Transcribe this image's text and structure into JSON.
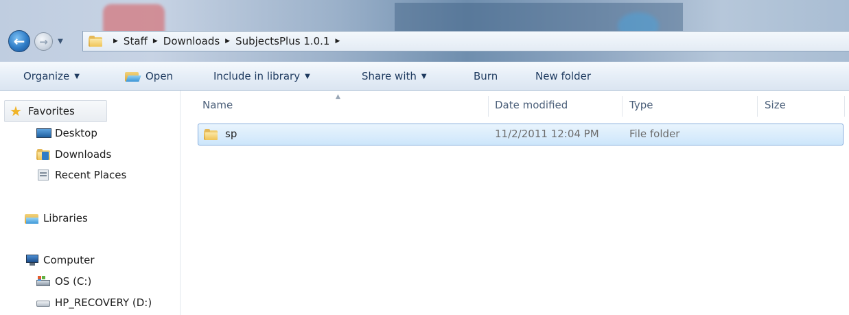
{
  "window": {
    "breadcrumb": [
      "Staff",
      "Downloads",
      "SubjectsPlus 1.0.1"
    ],
    "nav_icons": {
      "back": "back-arrow-icon",
      "forward": "forward-arrow-icon",
      "recent": "recent-pages-chevron-icon"
    }
  },
  "toolbar": {
    "organize": "Organize",
    "open": "Open",
    "include_in_library": "Include in library",
    "share_with": "Share with",
    "burn": "Burn",
    "new_folder": "New folder"
  },
  "navigation": {
    "favorites": {
      "label": "Favorites",
      "items": [
        "Desktop",
        "Downloads",
        "Recent Places"
      ]
    },
    "libraries": {
      "label": "Libraries"
    },
    "computer": {
      "label": "Computer",
      "items": [
        "OS (C:)",
        "HP_RECOVERY (D:)"
      ]
    }
  },
  "file_list": {
    "columns": [
      "Name",
      "Date modified",
      "Type",
      "Size"
    ],
    "rows": [
      {
        "name": "sp",
        "date_modified": "11/2/2011 12:04 PM",
        "type": "File folder",
        "size": "",
        "selected": true
      }
    ]
  },
  "colors": {
    "accent_blue": "#2f7cc6",
    "selection_fill": "#cde6fb",
    "selection_border": "#84acdd",
    "command_text": "#1e3a5f"
  }
}
